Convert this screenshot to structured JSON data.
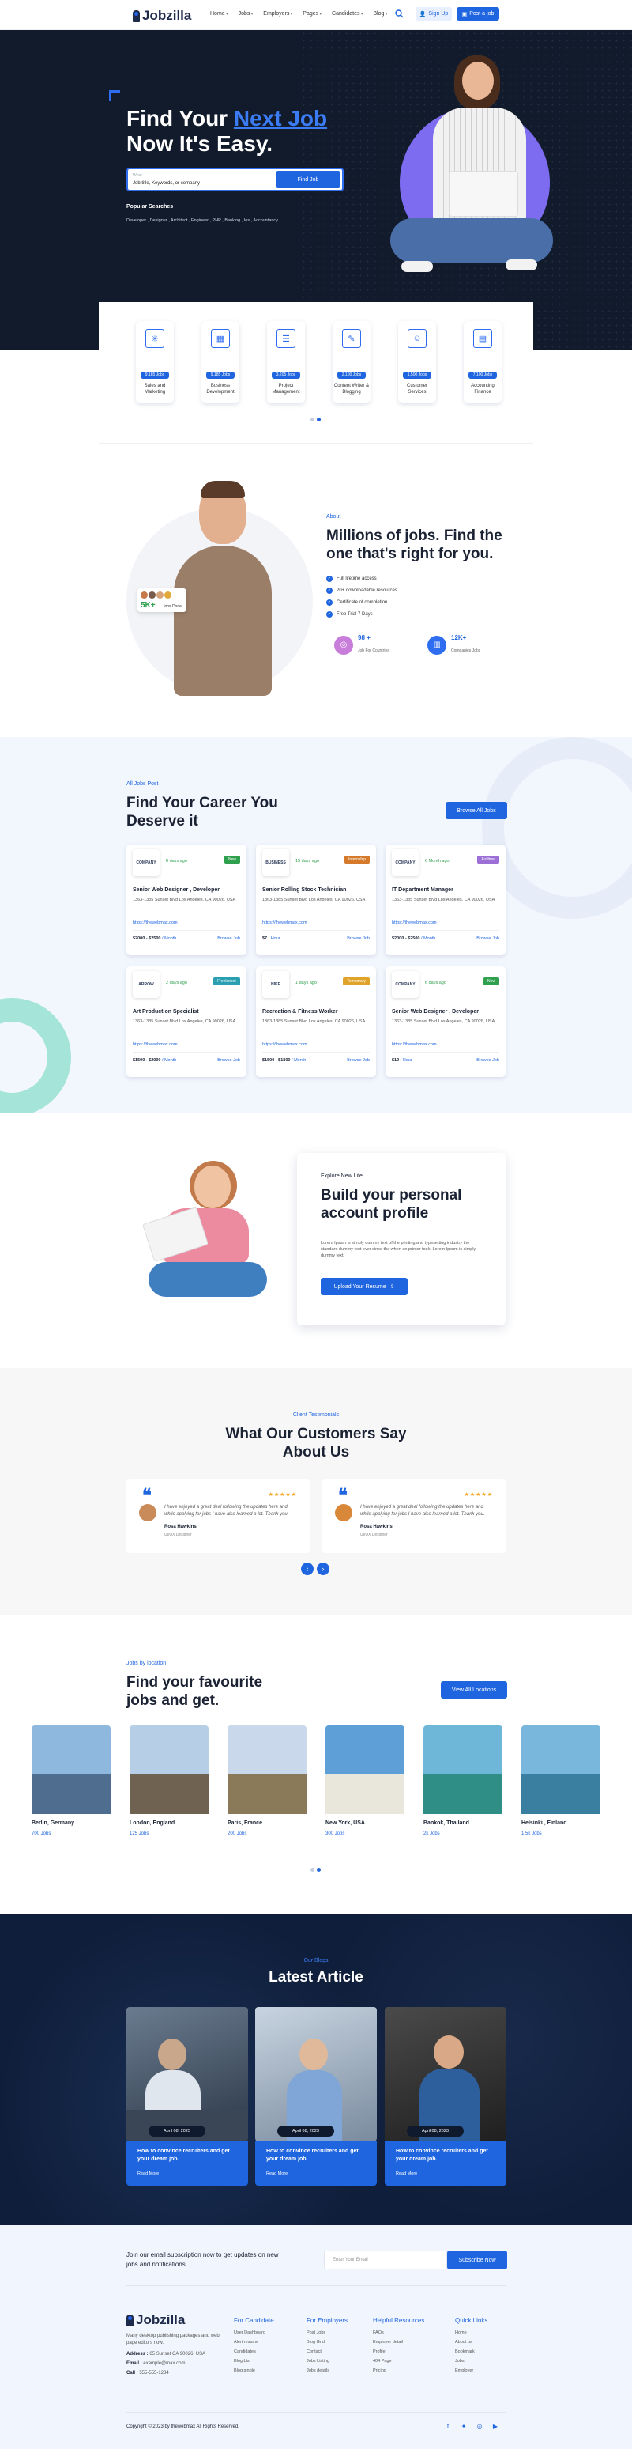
{
  "header": {
    "brand": "Jobzilla",
    "nav": [
      "Home",
      "Jobs",
      "Employers",
      "Pages",
      "Candidates",
      "Blog"
    ],
    "sign_up": "Sign Up",
    "post_job": "Post a job"
  },
  "hero": {
    "line1": "Find Your ",
    "accent": "Next Job",
    "line2": "Now It's Easy.",
    "search_label": "What",
    "search_placeholder": "Job title, Keywords, or company",
    "find_button": "Find Job",
    "popular_title": "Popular Searches",
    "popular_list": "Developer , Designer , Architect , Engineer , PHP , Banking , Ios , Accountancy..."
  },
  "categories": [
    {
      "count": "9,185 Jobs",
      "name": "Sales and Marketing",
      "icon": "chart-icon"
    },
    {
      "count": "9,185 Jobs",
      "name": "Business Development",
      "icon": "business-icon"
    },
    {
      "count": "3,205 Jobs",
      "name": "Project Management",
      "icon": "project-icon"
    },
    {
      "count": "2,100 Jobs",
      "name": "Content Writer & Blogging",
      "icon": "writer-icon"
    },
    {
      "count": "1,500 Jobs",
      "name": "Customer Services",
      "icon": "customer-icon"
    },
    {
      "count": "7,100 Jobs",
      "name": "Accounting Finance",
      "icon": "finance-icon"
    }
  ],
  "about": {
    "tag": "About",
    "title": "Millions of jobs. Find the one that's right for you.",
    "checks": [
      "Full lifetime access",
      "20+ downloadable resources",
      "Certificate of completion",
      "Free Trial 7 Days"
    ],
    "badge_count": "5K+",
    "badge_text": "Jobs Done",
    "stats": [
      {
        "value": "98 +",
        "label": "Job For Countries",
        "color": "#c77dd9"
      },
      {
        "value": "12K+",
        "label": "Companies Jobs",
        "color": "#2f6df0"
      }
    ]
  },
  "jobs": {
    "tag": "All Jobs Post",
    "title": "Find Your Career You Deserve it",
    "browse_all": "Browse All Jobs",
    "cards": [
      {
        "logo": "COMPANY",
        "ago": "8 days ago",
        "tag": "New",
        "tag_color": "#2fa04e",
        "title": "Senior Web Designer , Developer",
        "address": "1363-1385 Sunset Blvd Los Angeles, CA 90026, USA",
        "mail": "https://thewebmax.com",
        "salary": "$2000 - $2500",
        "period": " / Month",
        "browse": "Browse Job"
      },
      {
        "logo": "BUSINESS",
        "ago": "15 days ago",
        "tag": "Internship",
        "tag_color": "#d47a2a",
        "title": "Senior Rolling Stock Technician",
        "address": "1363-1385 Sunset Blvd Los Angeles, CA 90026, USA",
        "mail": "https://thewebmax.com",
        "salary": "$7",
        "period": " / Hour",
        "browse": "Browse Job"
      },
      {
        "logo": "COMPANY",
        "ago": "6 Month ago",
        "tag": "Fulltime",
        "tag_color": "#9b6fd6",
        "title": "IT Department Manager",
        "address": "1363-1385 Sunset Blvd Los Angeles, CA 90026, USA",
        "mail": "https://thewebmax.com",
        "salary": "$2000 - $2500",
        "period": " / Month",
        "browse": "Browse Job"
      },
      {
        "logo": "ARROW",
        "ago": "2 days ago",
        "tag": "Freelancer",
        "tag_color": "#2a9fb0",
        "title": "Art Production Specialist",
        "address": "1363-1385 Sunset Blvd Los Angeles, CA 90026, USA",
        "mail": "https://thewebmax.com",
        "salary": "$1500 - $2000",
        "period": " / Month",
        "browse": "Browse Job"
      },
      {
        "logo": "NIKE",
        "ago": "1 days ago",
        "tag": "Temporary",
        "tag_color": "#e0a32a",
        "title": "Recreation & Fitness Worker",
        "address": "1363-1385 Sunset Blvd Los Angeles, CA 90026, USA",
        "mail": "https://thewebmax.com",
        "salary": "$1500 - $1800",
        "period": " / Month",
        "browse": "Browse Job"
      },
      {
        "logo": "COMPANY",
        "ago": "6 days ago",
        "tag": "New",
        "tag_color": "#2fa04e",
        "title": "Senior Web Designer , Developer",
        "address": "1363-1385 Sunset Blvd Los Angeles, CA 90026, USA",
        "mail": "https://thewebmax.com",
        "salary": "$19",
        "period": " / Hour",
        "browse": "Browse Job"
      }
    ]
  },
  "profile": {
    "tag": "Explore New Life",
    "title": "Build your personal account profile",
    "text": "Lorem Ipsum is simply dummy text of the printing and typesetting industry the standard dummy text ever since the when an printer took. Lorem Ipsum is simply dummy text.",
    "upload": "Upload Your Resume"
  },
  "testimonials": {
    "tag": "Client Testimonials",
    "title": "What Our Customers Say About Us",
    "items": [
      {
        "text": "I have enjoyed a great deal following the updates here and while applying for jobs I have also learned a lot. Thank you.",
        "name": "Rosa Hawkins",
        "role": "UI/UX Designer"
      },
      {
        "text": "I have enjoyed a great deal following the updates here and while applying for jobs I have also learned a lot. Thank you.",
        "name": "Rosa Hawkins",
        "role": "UI/UX Designer"
      }
    ],
    "rating": "★★★★★"
  },
  "locations": {
    "tag": "Jobs by location",
    "title": "Find your favourite jobs and get.",
    "view_all": "View All Locations",
    "items": [
      {
        "name": "Berlin, Germany",
        "count": "700 Jobs",
        "sky": "#8fb8de",
        "ground": "#4f6d8f"
      },
      {
        "name": "London, England",
        "count": "125 Jobs",
        "sky": "#b7cfe6",
        "ground": "#6f6250"
      },
      {
        "name": "Paris, France",
        "count": "200 Jobs",
        "sky": "#c9d8ea",
        "ground": "#8a7a5a"
      },
      {
        "name": "New York, USA",
        "count": "300 Jobs",
        "sky": "#5f9fd8",
        "ground": "#e9e6dc"
      },
      {
        "name": "Bankok, Thailand",
        "count": "2k Jobs",
        "sky": "#6fb7d8",
        "ground": "#2f8f86"
      },
      {
        "name": "Helsinki , Finland",
        "count": "1.5k Jobs",
        "sky": "#7ab7dd",
        "ground": "#3a7fa0"
      }
    ]
  },
  "blog": {
    "tag": "Our Blogs",
    "title": "Latest Article",
    "items": [
      {
        "date": "April 08, 2023",
        "title": "How to convince recruiters and get your dream job.",
        "more": "Read More"
      },
      {
        "date": "April 08, 2023",
        "title": "How to convince recruiters and get your dream job.",
        "more": "Read More"
      },
      {
        "date": "April 08, 2023",
        "title": "How to convince recruiters and get your dream job.",
        "more": "Read More"
      }
    ]
  },
  "footer": {
    "newsletter_text": "Join our email subscription now to get updates on new jobs and notifications.",
    "email_placeholder": "Enter Your Email",
    "subscribe": "Subscribe Now",
    "brand": "Jobzilla",
    "desc": "Many desktop publishing packages and web page editors now.",
    "address_label": "Address :",
    "address": "65 Sunset CA 90026, USA",
    "email_label": "Email :",
    "email": "example@max.com",
    "call_label": "Call :",
    "call": "555-555-1234",
    "cols": [
      {
        "title": "For Candidate",
        "links": [
          "User Dashboard",
          "Alert resume",
          "Candidates",
          "Blog List",
          "Blog single"
        ]
      },
      {
        "title": "For Employers",
        "links": [
          "Post Jobs",
          "Blog Grid",
          "Contact",
          "Jobs Listing",
          "Jobs details"
        ]
      },
      {
        "title": "Helpful Resources",
        "links": [
          "FAQs",
          "Employer detail",
          "Profile",
          "404 Page",
          "Pricing"
        ]
      },
      {
        "title": "Quick Links",
        "links": [
          "Home",
          "About us",
          "Bookmark",
          "Jobs",
          "Employer"
        ]
      }
    ],
    "copyright": "Copyright © 2023 by thewebmax All Rights Reserved."
  },
  "colors": {
    "primary": "#1f65e0",
    "dark": "#111b2b",
    "light_bg": "#f2f6fd"
  }
}
